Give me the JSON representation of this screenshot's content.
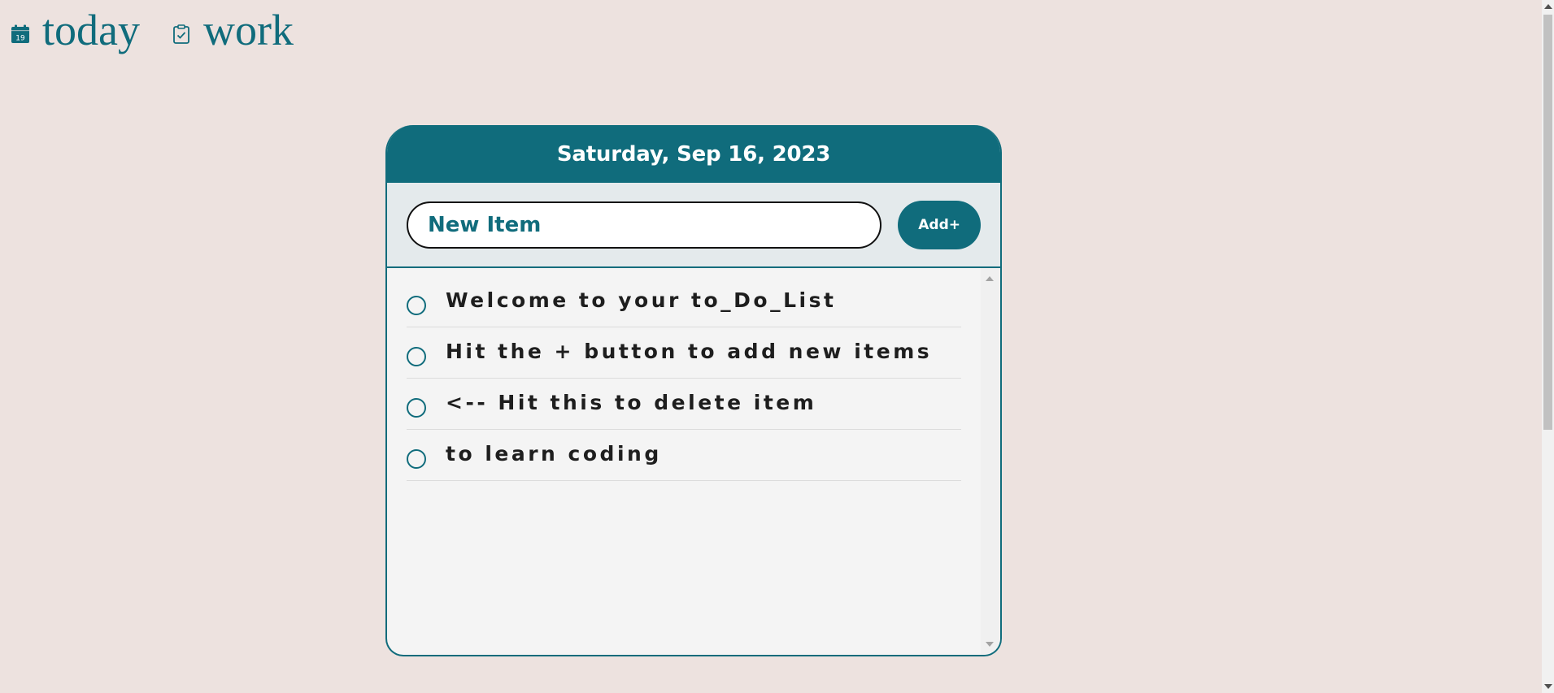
{
  "nav": {
    "items": [
      {
        "label": "today",
        "icon": "calendar-icon",
        "icon_text": "19"
      },
      {
        "label": "work",
        "icon": "clipboard-check-icon"
      }
    ]
  },
  "card": {
    "date_heading": "Saturday, Sep 16, 2023",
    "form": {
      "input_placeholder": "New Item",
      "add_label": "Add+"
    },
    "items": [
      {
        "text": "Welcome to your to_Do_List",
        "checked": false
      },
      {
        "text": "Hit the + button to add new items",
        "checked": false
      },
      {
        "text": "<-- Hit this to delete item",
        "checked": false
      },
      {
        "text": "to learn coding",
        "checked": false
      }
    ]
  },
  "colors": {
    "accent": "#106c7c",
    "background": "#ede2df",
    "card_body": "#f4f4f4"
  }
}
